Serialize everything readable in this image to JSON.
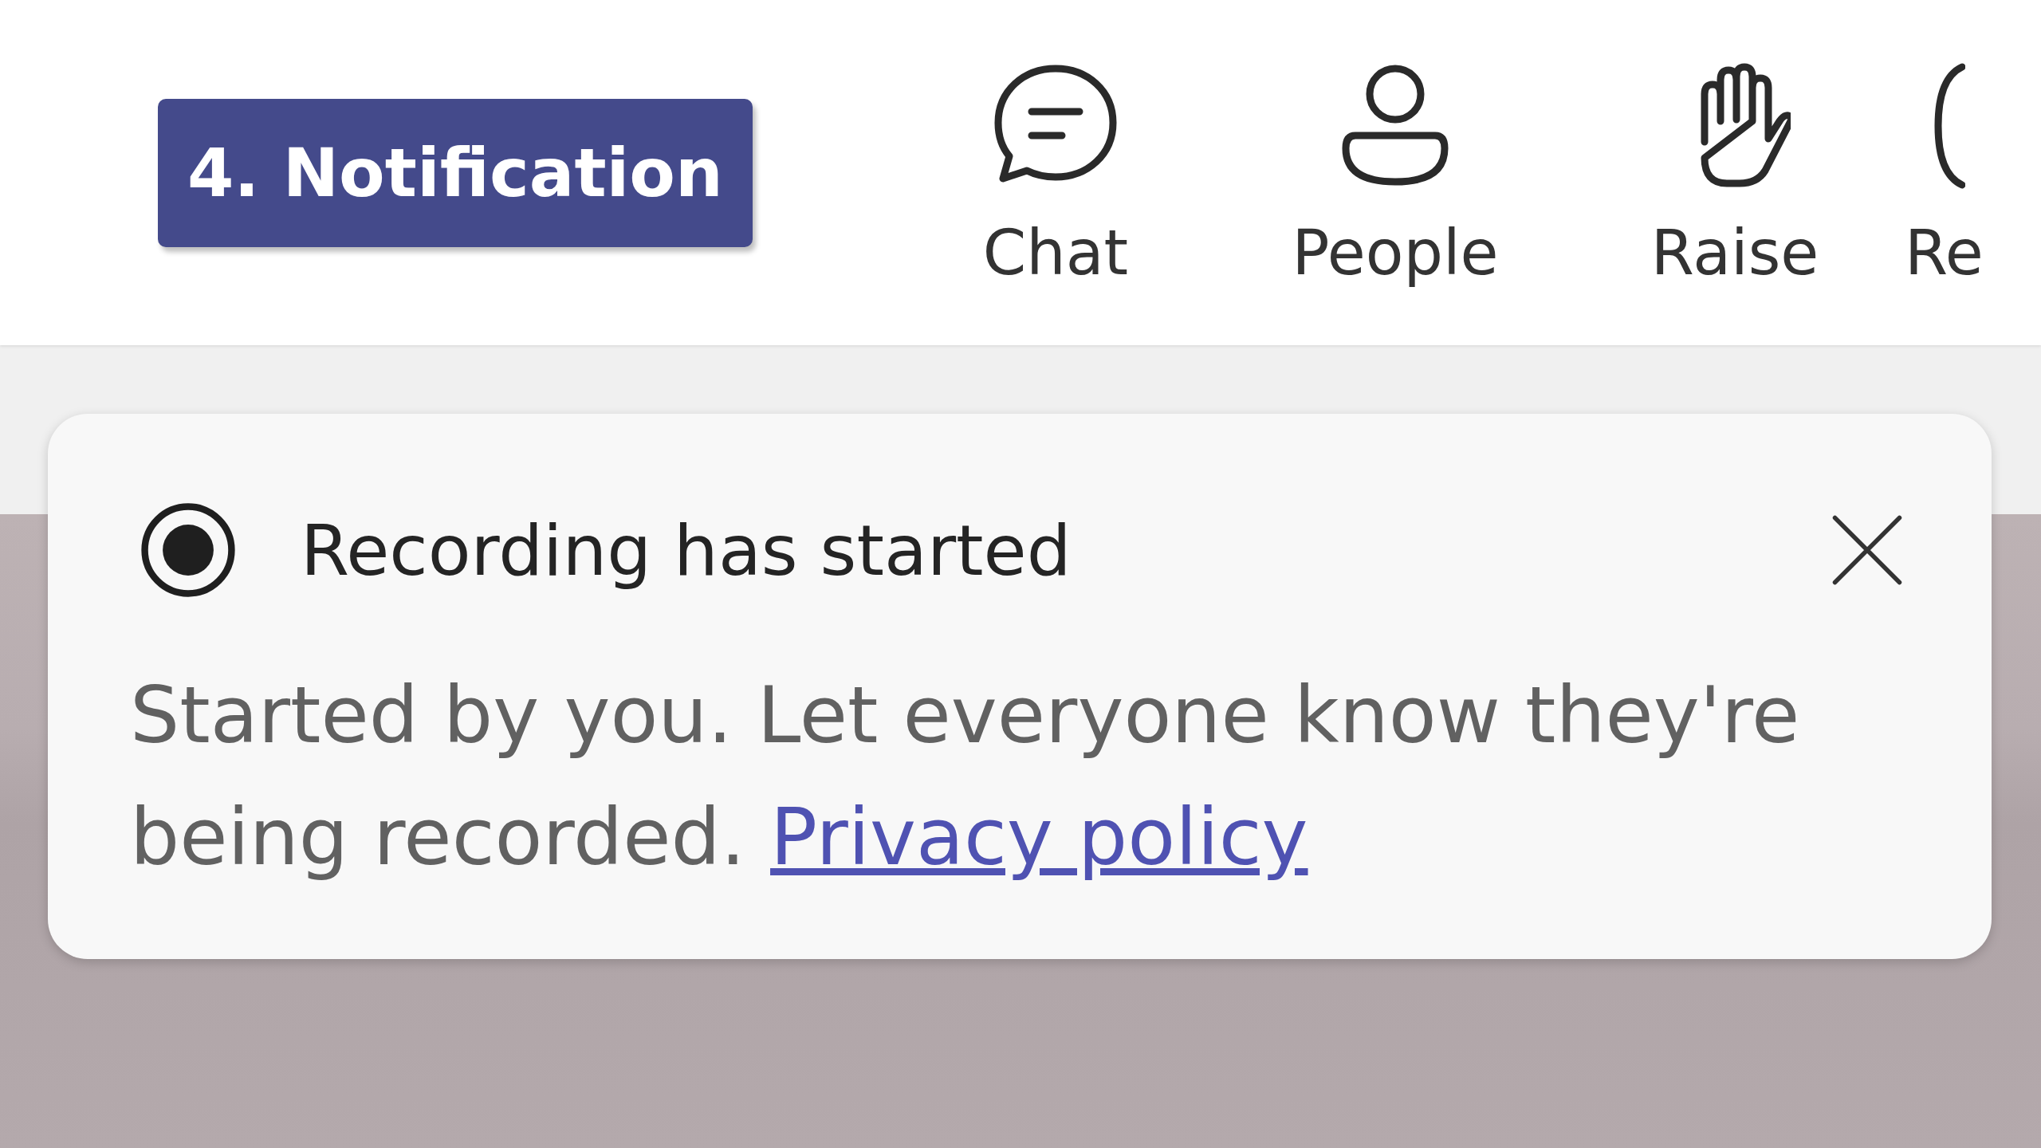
{
  "badge": {
    "text": "4. Notification"
  },
  "toolbar": {
    "items": [
      {
        "kind": "chat",
        "label": "Chat"
      },
      {
        "kind": "people",
        "label": "People"
      },
      {
        "kind": "raise",
        "label": "Raise"
      },
      {
        "kind": "partial",
        "label": "Re"
      }
    ]
  },
  "notification": {
    "title": "Recording has started",
    "body": "Started by you. Let everyone know they're being recorded. ",
    "link": "Privacy policy"
  }
}
